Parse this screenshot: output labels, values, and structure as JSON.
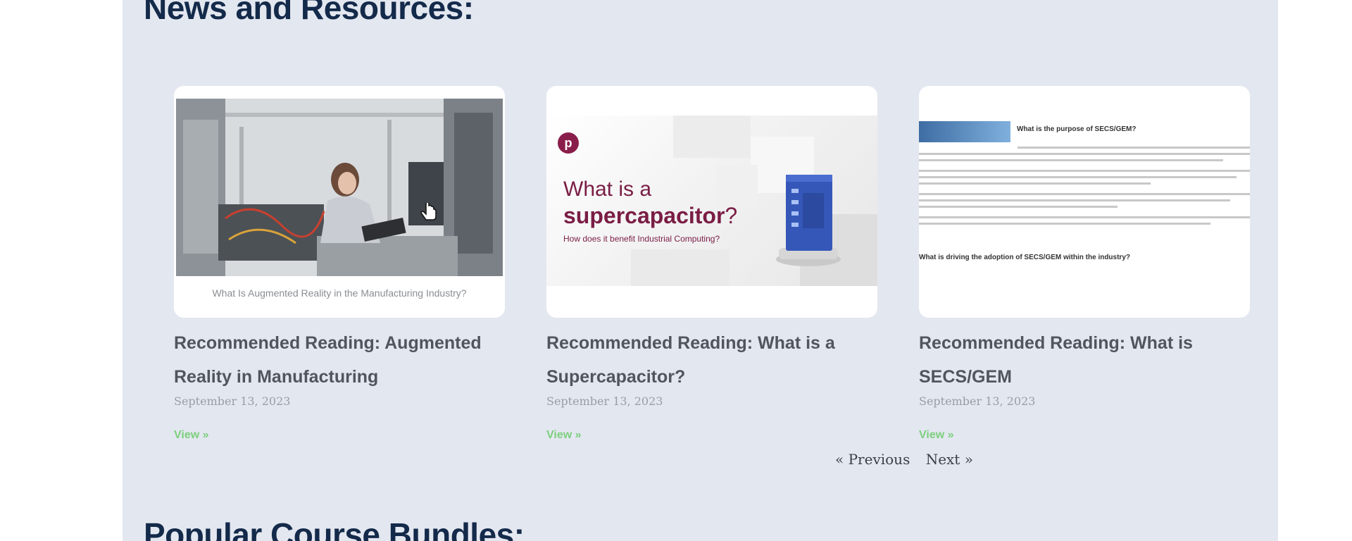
{
  "section": {
    "title": "News and Resources:"
  },
  "next_section": {
    "title": "Popular Course Bundles:"
  },
  "cards": [
    {
      "title": "Recommended Reading: Augmented Reality in Manufacturing",
      "date": "September 13, 2023",
      "link_label": "View »",
      "thumbnail": {
        "caption": "What Is Augmented Reality in the Manufacturing Industry?"
      }
    },
    {
      "title": "Recommended Reading: What is a Supercapacitor?",
      "date": "September 13, 2023",
      "link_label": "View »",
      "thumbnail": {
        "logo_letter": "p",
        "line1": "What is a",
        "line2": "supercapacitor",
        "line2_suffix": "?",
        "subtitle": "How does it benefit Industrial Computing?"
      }
    },
    {
      "title": "Recommended Reading: What is SECS/GEM",
      "date": "September 13, 2023",
      "link_label": "View »",
      "thumbnail": {
        "heading": "What is the purpose of SECS/GEM?",
        "subheading": "What is driving the adoption of SECS/GEM within the industry?"
      }
    }
  ],
  "pagination": {
    "previous_label": "« Previous",
    "next_label": "Next »"
  },
  "colors": {
    "panel_bg": "#e3e7f0",
    "title": "#142a4a",
    "card_title": "#50555e",
    "date": "#9a9da3",
    "link": "#7ccf7d",
    "brand_maroon": "#7a1d45"
  }
}
